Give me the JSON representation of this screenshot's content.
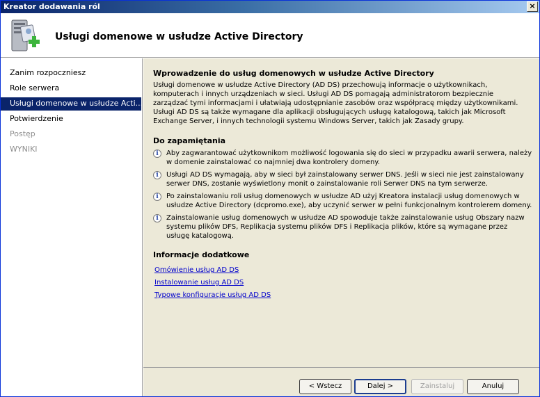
{
  "window": {
    "title": "Kreator dodawania ról",
    "close_label": "×"
  },
  "header": {
    "title": "Usługi domenowe w usłudze Active Directory"
  },
  "sidebar": {
    "items": [
      {
        "label": "Zanim rozpoczniesz",
        "state": "normal"
      },
      {
        "label": "Role serwera",
        "state": "normal"
      },
      {
        "label": "Usługi domenowe w usłudze Acti...",
        "state": "active"
      },
      {
        "label": "Potwierdzenie",
        "state": "normal"
      },
      {
        "label": "Postęp",
        "state": "disabled"
      },
      {
        "label": "WYNIKI",
        "state": "disabled"
      }
    ]
  },
  "main": {
    "intro_heading": "Wprowadzenie do usług domenowych w usłudze Active Directory",
    "intro_text": "Usługi domenowe w usłudze Active Directory (AD DS) przechowują informacje o użytkownikach, komputerach i innych urządzeniach w sieci. Usługi AD DS pomagają administratorom bezpiecznie zarządzać tymi informacjami i ułatwiają udostępnianie zasobów oraz współpracę między użytkownikami. Usługi AD DS są także wymagane dla aplikacji obsługujących usługę katalogową, takich jak Microsoft Exchange Server, i innych technologii systemu Windows Server, takich jak Zasady grupy.",
    "notes_heading": "Do zapamiętania",
    "notes": [
      "Aby zagwarantować użytkownikom możliwość logowania się do sieci w przypadku awarii serwera, należy w domenie zainstalować co najmniej dwa kontrolery domeny.",
      "Usługi AD DS wymagają, aby w sieci był zainstalowany serwer DNS. Jeśli w sieci nie jest zainstalowany serwer DNS, zostanie wyświetlony monit o zainstalowanie roli Serwer DNS na tym serwerze.",
      "Po zainstalowaniu roli usług domenowych w usłudze AD użyj Kreatora instalacji usług domenowych w usłudze Active Directory (dcpromo.exe), aby uczynić serwer w pełni funkcjonalnym kontrolerem domeny.",
      "Zainstalowanie usług domenowych w usłudze AD spowoduje także zainstalowanie usług Obszary nazw systemu plików DFS, Replikacja systemu plików DFS i Replikacja plików, które są wymagane przez usługę katalogową."
    ],
    "more_heading": "Informacje dodatkowe",
    "links": [
      "Omówienie usług AD DS",
      "Instalowanie usług AD DS",
      "Typowe konfiguracje usług AD DS"
    ]
  },
  "footer": {
    "back_label": "< Wstecz",
    "next_label": "Dalej >",
    "install_label": "Zainstaluj",
    "cancel_label": "Anuluj"
  }
}
